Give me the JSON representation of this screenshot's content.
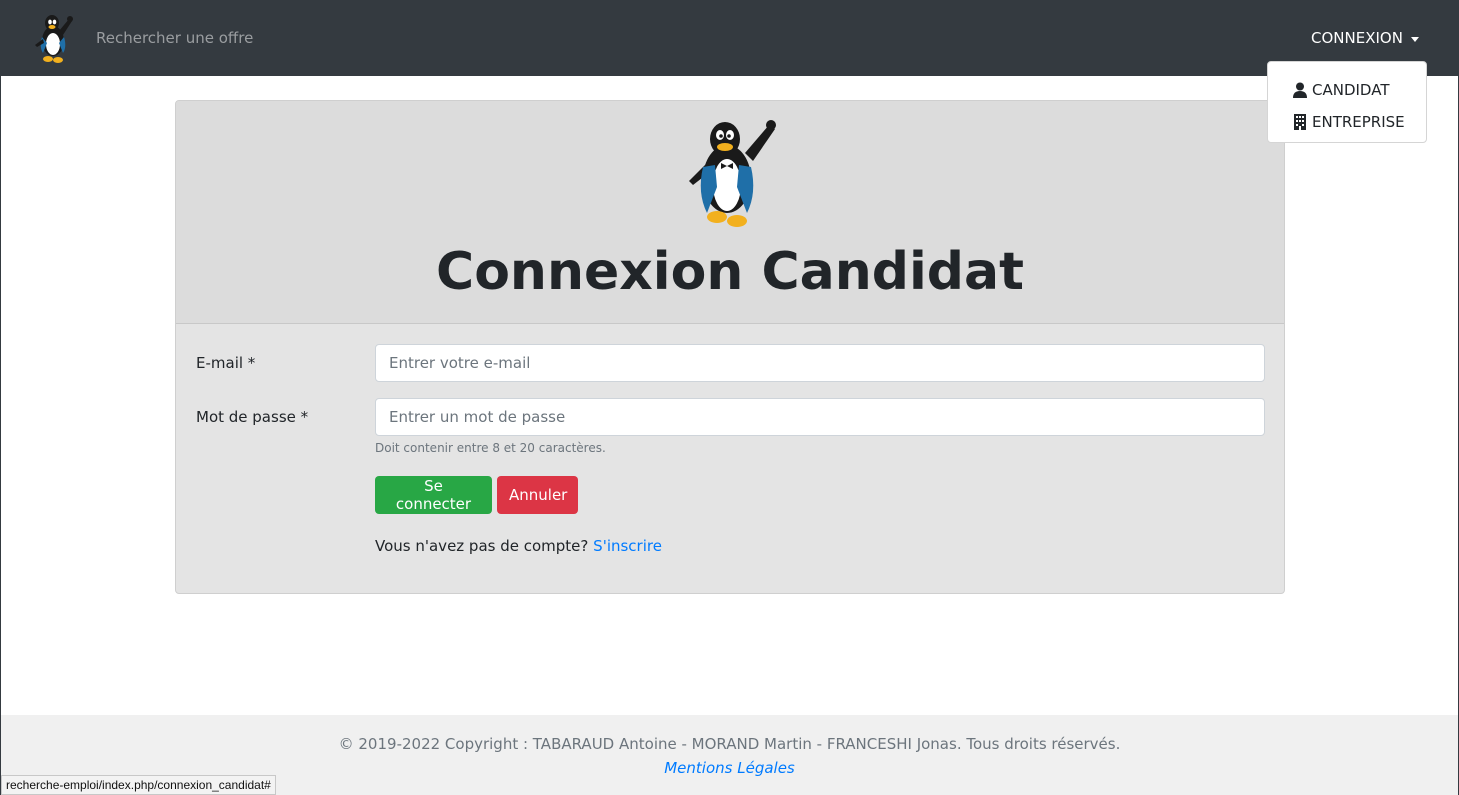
{
  "navbar": {
    "logo_icon": "tux-penguin-logo",
    "search_link": "Rechercher une offre",
    "connexion_label": "CONNEXION",
    "bg_color": "#343a40"
  },
  "dropdown": {
    "items": [
      {
        "label": "CANDIDAT",
        "icon": "user-icon"
      },
      {
        "label": "ENTREPRISE",
        "icon": "building-icon"
      }
    ]
  },
  "card": {
    "header_logo": "tux-penguin-waving",
    "title": "Connexion Candidat",
    "email": {
      "label": "E-mail *",
      "placeholder": "Entrer votre e-mail",
      "value": ""
    },
    "password": {
      "label": "Mot de passe *",
      "placeholder": "Entrer un mot de passe",
      "value": "",
      "help": "Doit contenir entre 8 et 20 caractères."
    },
    "buttons": {
      "submit": "Se connecter",
      "cancel": "Annuler"
    },
    "signup": {
      "text": "Vous n'avez pas de compte?",
      "link": "S'inscrire"
    }
  },
  "footer": {
    "copyright": "© 2019-2022 Copyright : TABARAUD Antoine - MORAND Martin - FRANCESHI Jonas. Tous droits réservés.",
    "legal_link": "Mentions Légales"
  },
  "status_bar": {
    "url": "recherche-emploi/index.php/connexion_candidat#"
  },
  "colors": {
    "success": "#28a745",
    "danger": "#dc3545",
    "link": "#007bff"
  }
}
